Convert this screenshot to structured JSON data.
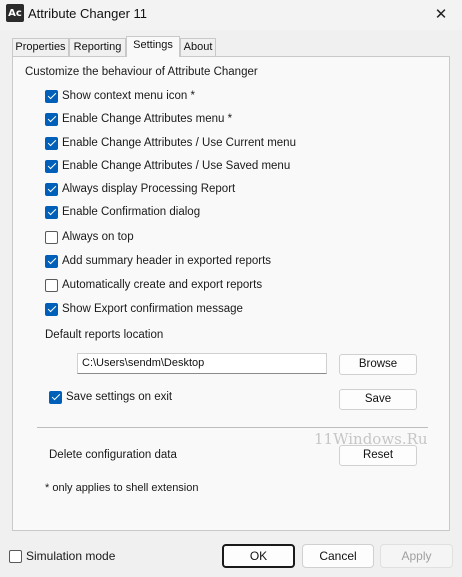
{
  "window": {
    "title": "Attribute Changer 11",
    "icon_text": "Ac",
    "close_glyph": "✕"
  },
  "tabs": [
    {
      "label": "Properties",
      "active": false
    },
    {
      "label": "Reporting",
      "active": false
    },
    {
      "label": "Settings",
      "active": true
    },
    {
      "label": "About",
      "active": false
    }
  ],
  "settings": {
    "heading": "Customize the behaviour of Attribute Changer",
    "options": [
      {
        "label": "Show context menu icon *",
        "checked": true
      },
      {
        "label": "Enable Change Attributes menu *",
        "checked": true
      },
      {
        "label": "Enable Change Attributes / Use Current menu",
        "checked": true
      },
      {
        "label": "Enable Change Attributes / Use Saved menu",
        "checked": true
      },
      {
        "label": "Always display Processing Report",
        "checked": true
      },
      {
        "label": "Enable Confirmation dialog",
        "checked": true
      },
      {
        "label": "Always on top",
        "checked": false
      },
      {
        "label": "Add summary header in exported reports",
        "checked": true
      },
      {
        "label": "Automatically create and export reports",
        "checked": false
      },
      {
        "label": "Show Export confirmation message",
        "checked": true
      }
    ],
    "reports_location_label": "Default reports location",
    "reports_location_value": "C:\\Users\\sendm\\Desktop",
    "browse_label": "Browse",
    "save_on_exit_label": "Save settings on exit",
    "save_on_exit_checked": true,
    "save_label": "Save",
    "delete_config_label": "Delete configuration data",
    "reset_label": "Reset",
    "note": "* only applies to shell extension"
  },
  "watermark": "11Windows.Ru",
  "footer": {
    "simulation_mode_label": "Simulation mode",
    "simulation_mode_checked": false,
    "ok_label": "OK",
    "cancel_label": "Cancel",
    "apply_label": "Apply"
  },
  "colors": {
    "accent": "#005fb8",
    "panel": "#f9f9f9",
    "window": "#f0f0f0"
  }
}
